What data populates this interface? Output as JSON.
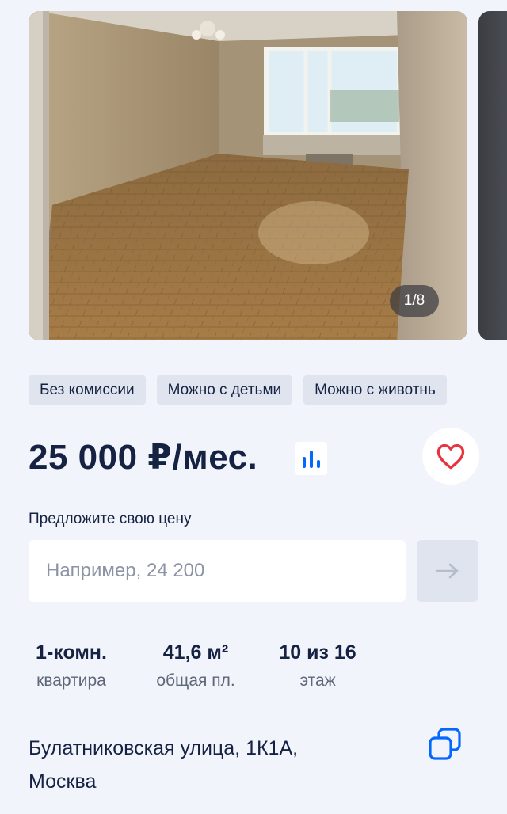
{
  "gallery": {
    "counter": "1/8"
  },
  "chips": [
    {
      "label": "Без комиссии"
    },
    {
      "label": "Можно с детьми"
    },
    {
      "label": "Можно с животнь"
    }
  ],
  "price": {
    "text": "25 000 ₽/мес."
  },
  "offer": {
    "label": "Предложите свою цену",
    "placeholder": "Например, 24 200",
    "value": ""
  },
  "stats": {
    "rooms": {
      "value": "1-комн.",
      "label": "квартира"
    },
    "area": {
      "value": "41,6 м²",
      "label": "общая пл."
    },
    "floor": {
      "value": "10 из 16",
      "label": "этаж"
    }
  },
  "address": {
    "line1": "Булатниковская улица, 1К1А,",
    "line2": "Москва"
  },
  "icons": {
    "favorite": "heart-icon",
    "price_chart": "bar-chart-icon",
    "submit": "arrow-right-icon",
    "copy": "copy-icon"
  },
  "colors": {
    "background": "#f1f4fb",
    "text": "#152242",
    "accent": "#0468ff",
    "favorite": "#e8343e",
    "chip": "#dfe4ee"
  }
}
